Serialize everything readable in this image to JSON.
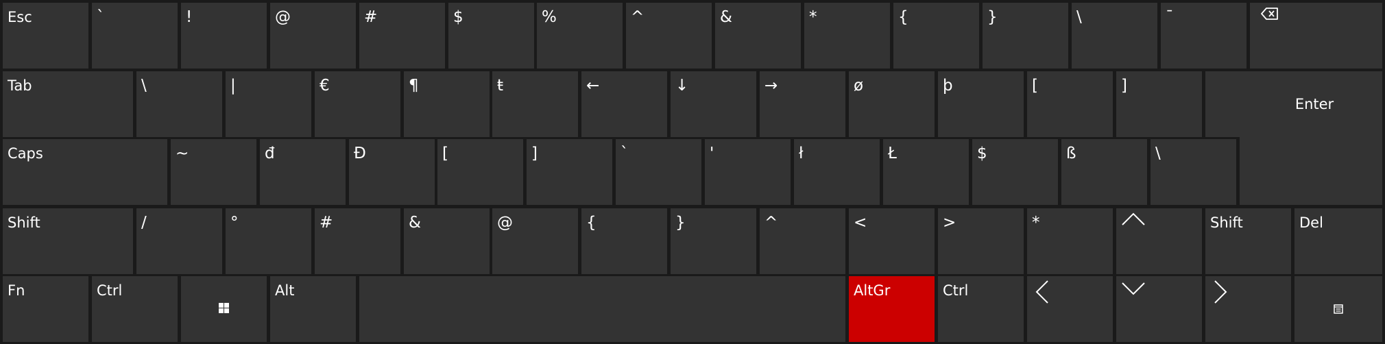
{
  "keyboard": {
    "accent_color": "#cc0000",
    "key_color": "#333333",
    "background_color": "#1a1a1a",
    "rows": [
      [
        {
          "name": "esc-key",
          "label": "Esc"
        },
        {
          "name": "backtick-key",
          "label": "`"
        },
        {
          "name": "exclamation-key",
          "label": "!"
        },
        {
          "name": "at-key",
          "label": "@"
        },
        {
          "name": "hash-key",
          "label": "#"
        },
        {
          "name": "dollar-key",
          "label": "$"
        },
        {
          "name": "percent-key",
          "label": "%"
        },
        {
          "name": "caret-key",
          "label": "^"
        },
        {
          "name": "ampersand-key",
          "label": "&"
        },
        {
          "name": "asterisk-key",
          "label": "*"
        },
        {
          "name": "open-brace-key",
          "label": "{"
        },
        {
          "name": "close-brace-key",
          "label": "}"
        },
        {
          "name": "backslash-key",
          "label": "\\"
        },
        {
          "name": "macron-key",
          "label": "¯"
        },
        {
          "name": "backspace-key",
          "label": "",
          "icon": "backspace-icon"
        }
      ],
      [
        {
          "name": "tab-key",
          "label": "Tab"
        },
        {
          "name": "backslash-key",
          "label": "\\"
        },
        {
          "name": "pipe-key",
          "label": "|"
        },
        {
          "name": "euro-key",
          "label": "€"
        },
        {
          "name": "pilcrow-key",
          "label": "¶"
        },
        {
          "name": "t-stroke-key",
          "label": "ŧ"
        },
        {
          "name": "left-arrow-symbol-key",
          "label": "←"
        },
        {
          "name": "down-arrow-symbol-key",
          "label": "↓"
        },
        {
          "name": "right-arrow-symbol-key",
          "label": "→"
        },
        {
          "name": "o-slash-key",
          "label": "ø"
        },
        {
          "name": "thorn-key",
          "label": "þ"
        },
        {
          "name": "open-bracket-key",
          "label": "["
        },
        {
          "name": "close-bracket-key",
          "label": "]"
        },
        {
          "name": "enter-key",
          "label": "Enter"
        }
      ],
      [
        {
          "name": "caps-key",
          "label": "Caps"
        },
        {
          "name": "tilde-key",
          "label": "~"
        },
        {
          "name": "d-stroke-key",
          "label": "đ"
        },
        {
          "name": "capital-d-stroke-key",
          "label": "Đ"
        },
        {
          "name": "open-bracket-key",
          "label": "["
        },
        {
          "name": "close-bracket-key",
          "label": "]"
        },
        {
          "name": "backtick-key",
          "label": "`"
        },
        {
          "name": "apostrophe-key",
          "label": "'"
        },
        {
          "name": "l-stroke-key",
          "label": "ł"
        },
        {
          "name": "capital-l-stroke-key",
          "label": "Ł"
        },
        {
          "name": "dollar-key",
          "label": "$"
        },
        {
          "name": "sharp-s-key",
          "label": "ß"
        },
        {
          "name": "backslash-key",
          "label": "\\"
        }
      ],
      [
        {
          "name": "left-shift-key",
          "label": "Shift"
        },
        {
          "name": "slash-key",
          "label": "/"
        },
        {
          "name": "degree-key",
          "label": "°"
        },
        {
          "name": "hash-key",
          "label": "#"
        },
        {
          "name": "ampersand-key",
          "label": "&"
        },
        {
          "name": "at-key",
          "label": "@"
        },
        {
          "name": "open-brace-key",
          "label": "{"
        },
        {
          "name": "close-brace-key",
          "label": "}"
        },
        {
          "name": "caret-key",
          "label": "^"
        },
        {
          "name": "less-than-key",
          "label": "<"
        },
        {
          "name": "greater-than-key",
          "label": ">"
        },
        {
          "name": "asterisk-key",
          "label": "*"
        },
        {
          "name": "up-arrow-key",
          "label": "",
          "icon": "chevron-up-icon"
        },
        {
          "name": "right-shift-key",
          "label": "Shift"
        },
        {
          "name": "del-key",
          "label": "Del"
        }
      ],
      [
        {
          "name": "fn-key",
          "label": "Fn"
        },
        {
          "name": "left-ctrl-key",
          "label": "Ctrl"
        },
        {
          "name": "windows-key",
          "label": "",
          "icon": "windows-icon"
        },
        {
          "name": "alt-key",
          "label": "Alt"
        },
        {
          "name": "space-key",
          "label": ""
        },
        {
          "name": "altgr-key",
          "label": "AltGr",
          "active": true
        },
        {
          "name": "right-ctrl-key",
          "label": "Ctrl"
        },
        {
          "name": "left-arrow-key",
          "label": "",
          "icon": "chevron-left-icon"
        },
        {
          "name": "down-arrow-key",
          "label": "",
          "icon": "chevron-down-icon"
        },
        {
          "name": "right-arrow-key",
          "label": "",
          "icon": "chevron-right-icon"
        },
        {
          "name": "options-key",
          "label": "",
          "icon": "options-icon"
        }
      ]
    ]
  }
}
